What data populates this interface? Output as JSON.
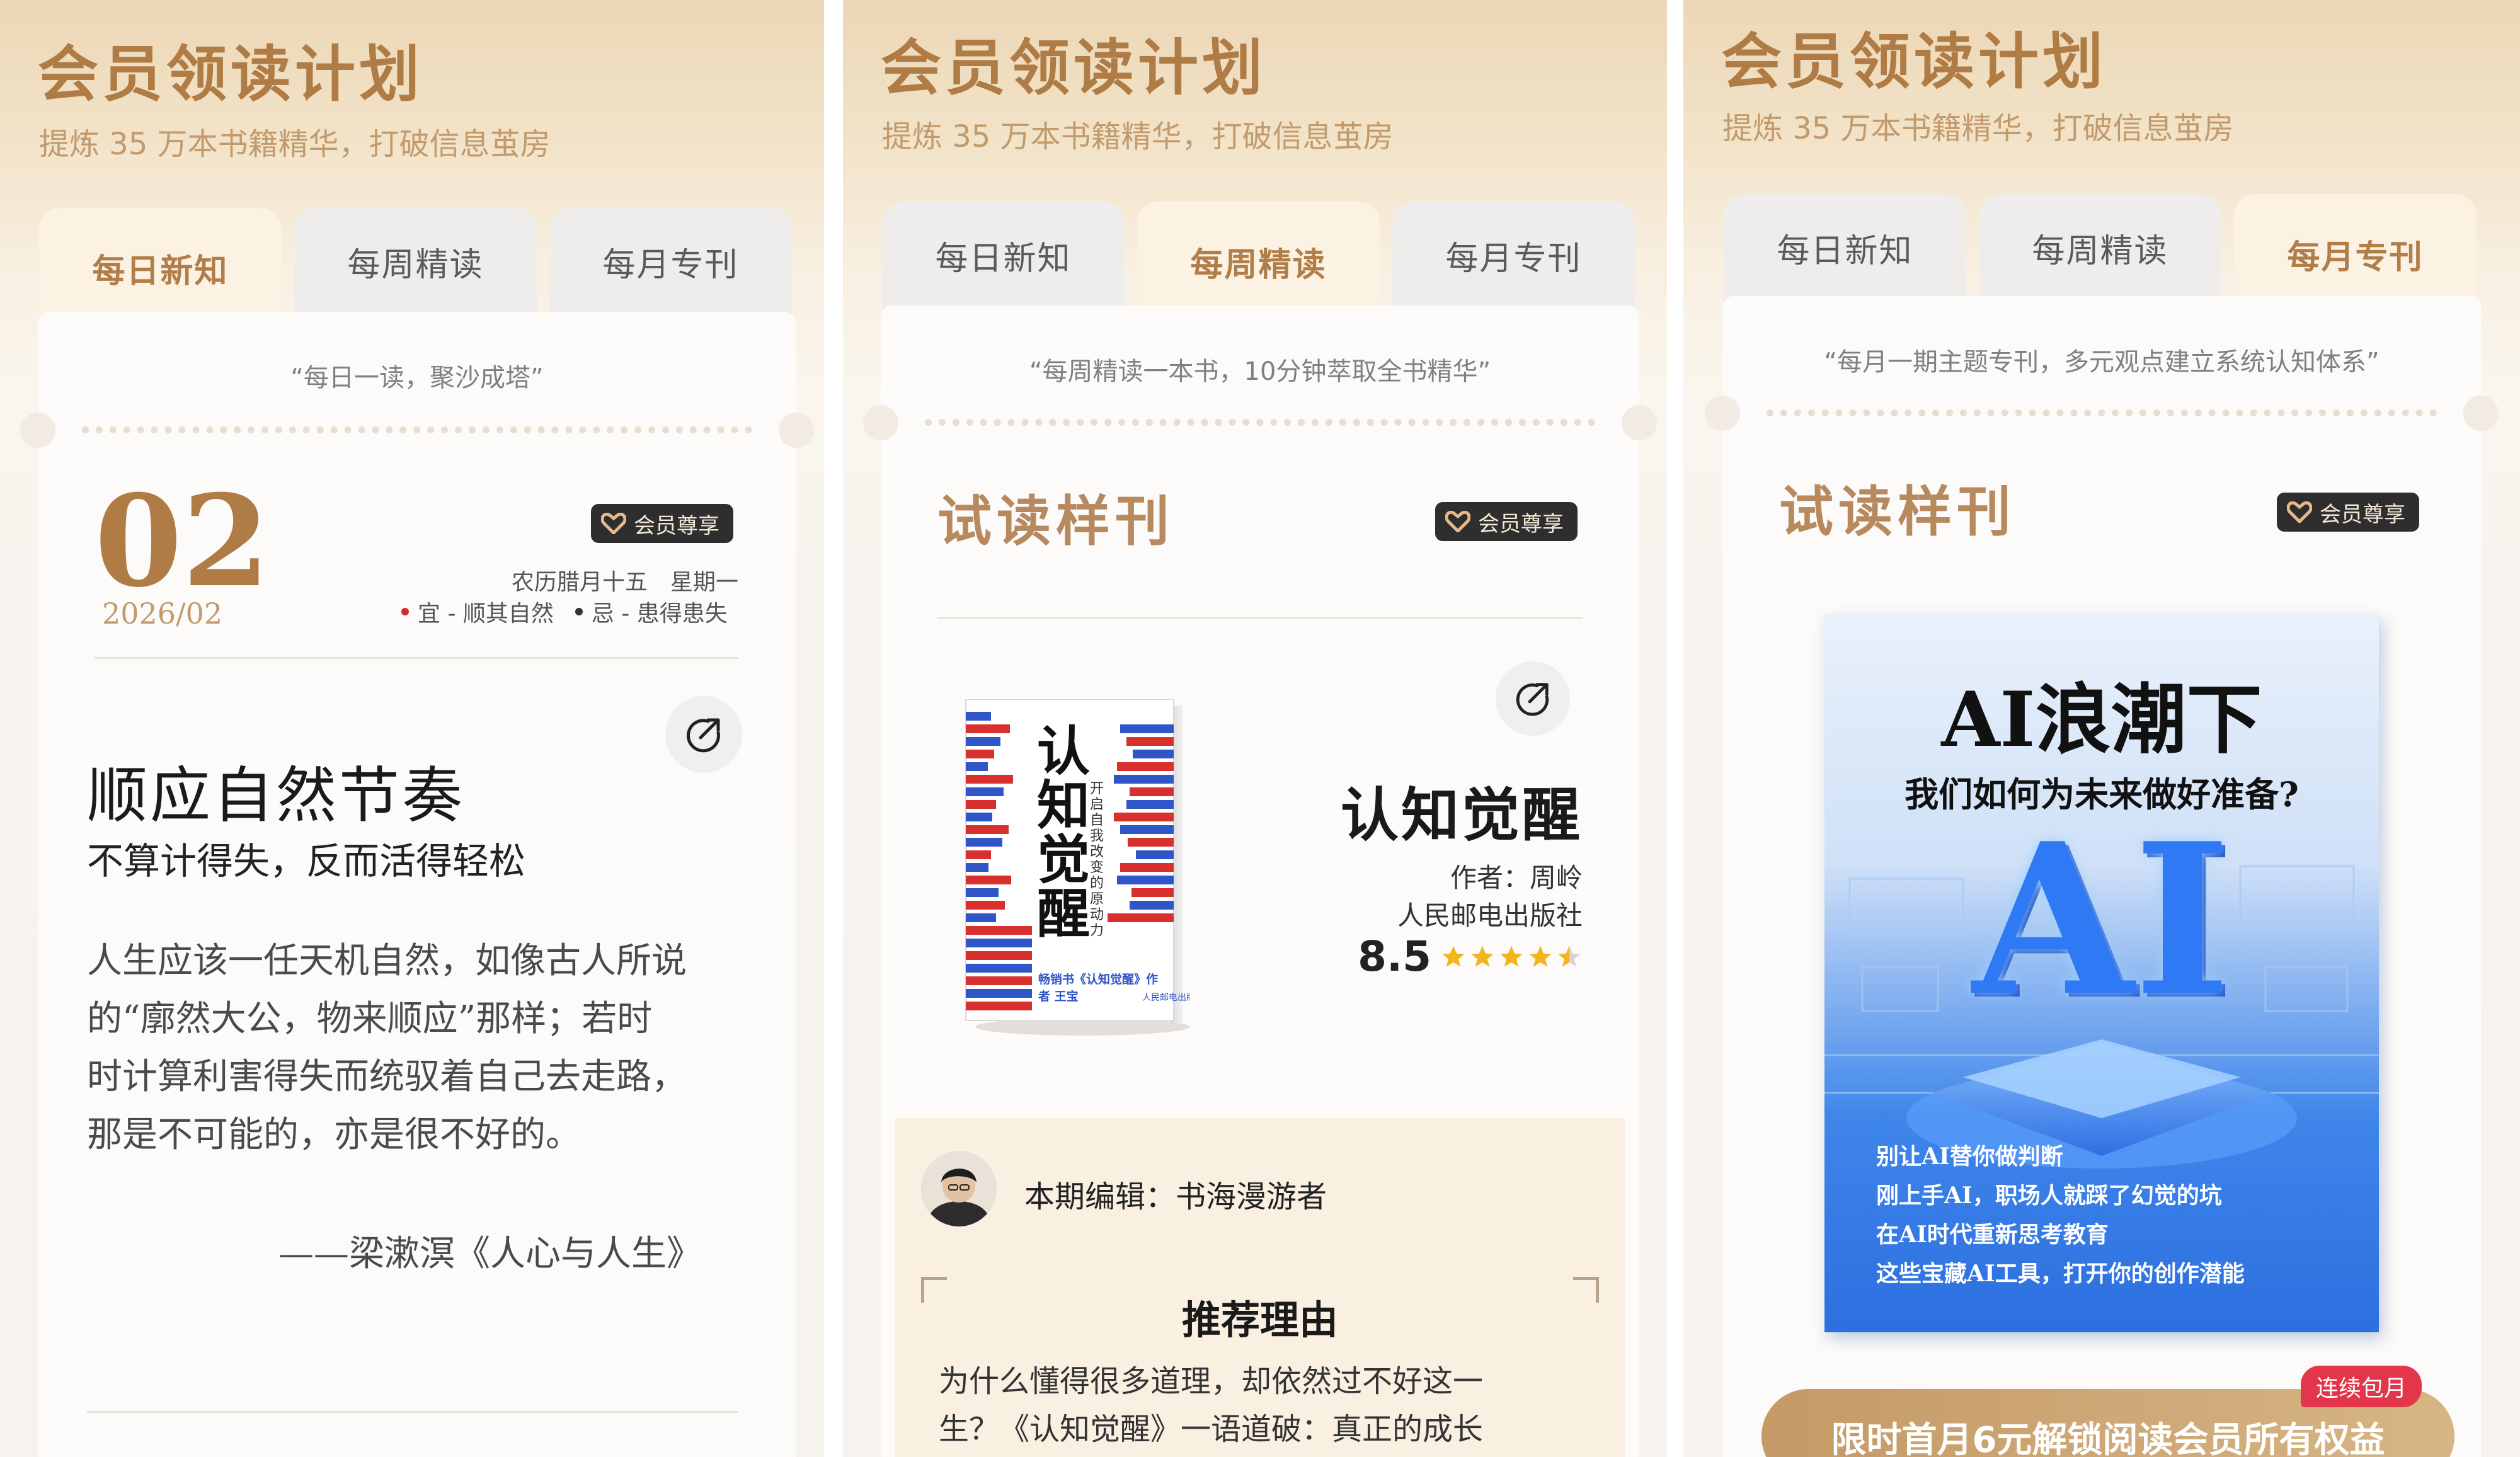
{
  "colors": {
    "accent": "#b07c45",
    "tab_active_bg": "#fbf2e4",
    "badge_bg": "#2e2e2e",
    "cta_bg": "#c8a270",
    "cta_tag_bg": "#e3364a"
  },
  "header": {
    "title": "会员领读计划",
    "subtitle": "提炼 35 万本书籍精华，打破信息茧房"
  },
  "tabs": [
    "每日新知",
    "每周精读",
    "每月专刊"
  ],
  "badge_label": "会员尊享",
  "daily": {
    "active_tab": 0,
    "quote": "“每日一读，聚沙成塔”",
    "date_day": "02",
    "date_year_month": "2026/02",
    "lunar": "农历腊月十五　星期一",
    "yi": "宜 - 顺其自然",
    "ji": "忌 - 患得患失",
    "article_title": "顺应自然节奏",
    "article_subtitle": "不算计得失，反而活得轻松",
    "body_lines": [
      "人生应该一任天机自然，如像古人所说",
      "的“廓然大公，物来顺应”那样；若时",
      "时计算利害得失而统驭着自己去走路，",
      "那是不可能的，亦是很不好的。"
    ],
    "attribution": "——梁漱溟《人心与人生》"
  },
  "weekly": {
    "active_tab": 1,
    "quote": "“每周精读一本书，10分钟萃取全书精华”",
    "sample_title": "试读样刊",
    "book_title": "认知觉醒",
    "author": "作者：周岭",
    "publisher": "人民邮电出版社",
    "rating": "8.5",
    "rating_value": 4.5,
    "cover_title": "认知觉醒",
    "cover_subtitle": "开启自我改变的原动力",
    "cover_tagline": "畅销书《认知觉醒》作者 王宝",
    "editor_label": "本期编辑：书海漫游者",
    "reason_title": "推荐理由",
    "reason_lines": [
      "为什么懂得很多道理，却依然过不好这一",
      "生？《认知觉醒》一语道破：真正的成长"
    ]
  },
  "monthly": {
    "active_tab": 2,
    "quote": "“每月一期主题专刊，多元观点建立系统认知体系”",
    "sample_title": "试读样刊",
    "cover_title": "AI浪潮下",
    "cover_subtitle": "我们如何为未来做好准备?",
    "cover_glyph": "AI",
    "cover_bullets": [
      "别让AI替你做判断",
      "刚上手AI，职场人就踩了幻觉的坑",
      "在AI时代重新思考教育",
      "这些宝藏AI工具，打开你的创作潜能"
    ],
    "cta_label": "限时首月6元解锁阅读会员所有权益",
    "cta_tag": "连续包月"
  }
}
